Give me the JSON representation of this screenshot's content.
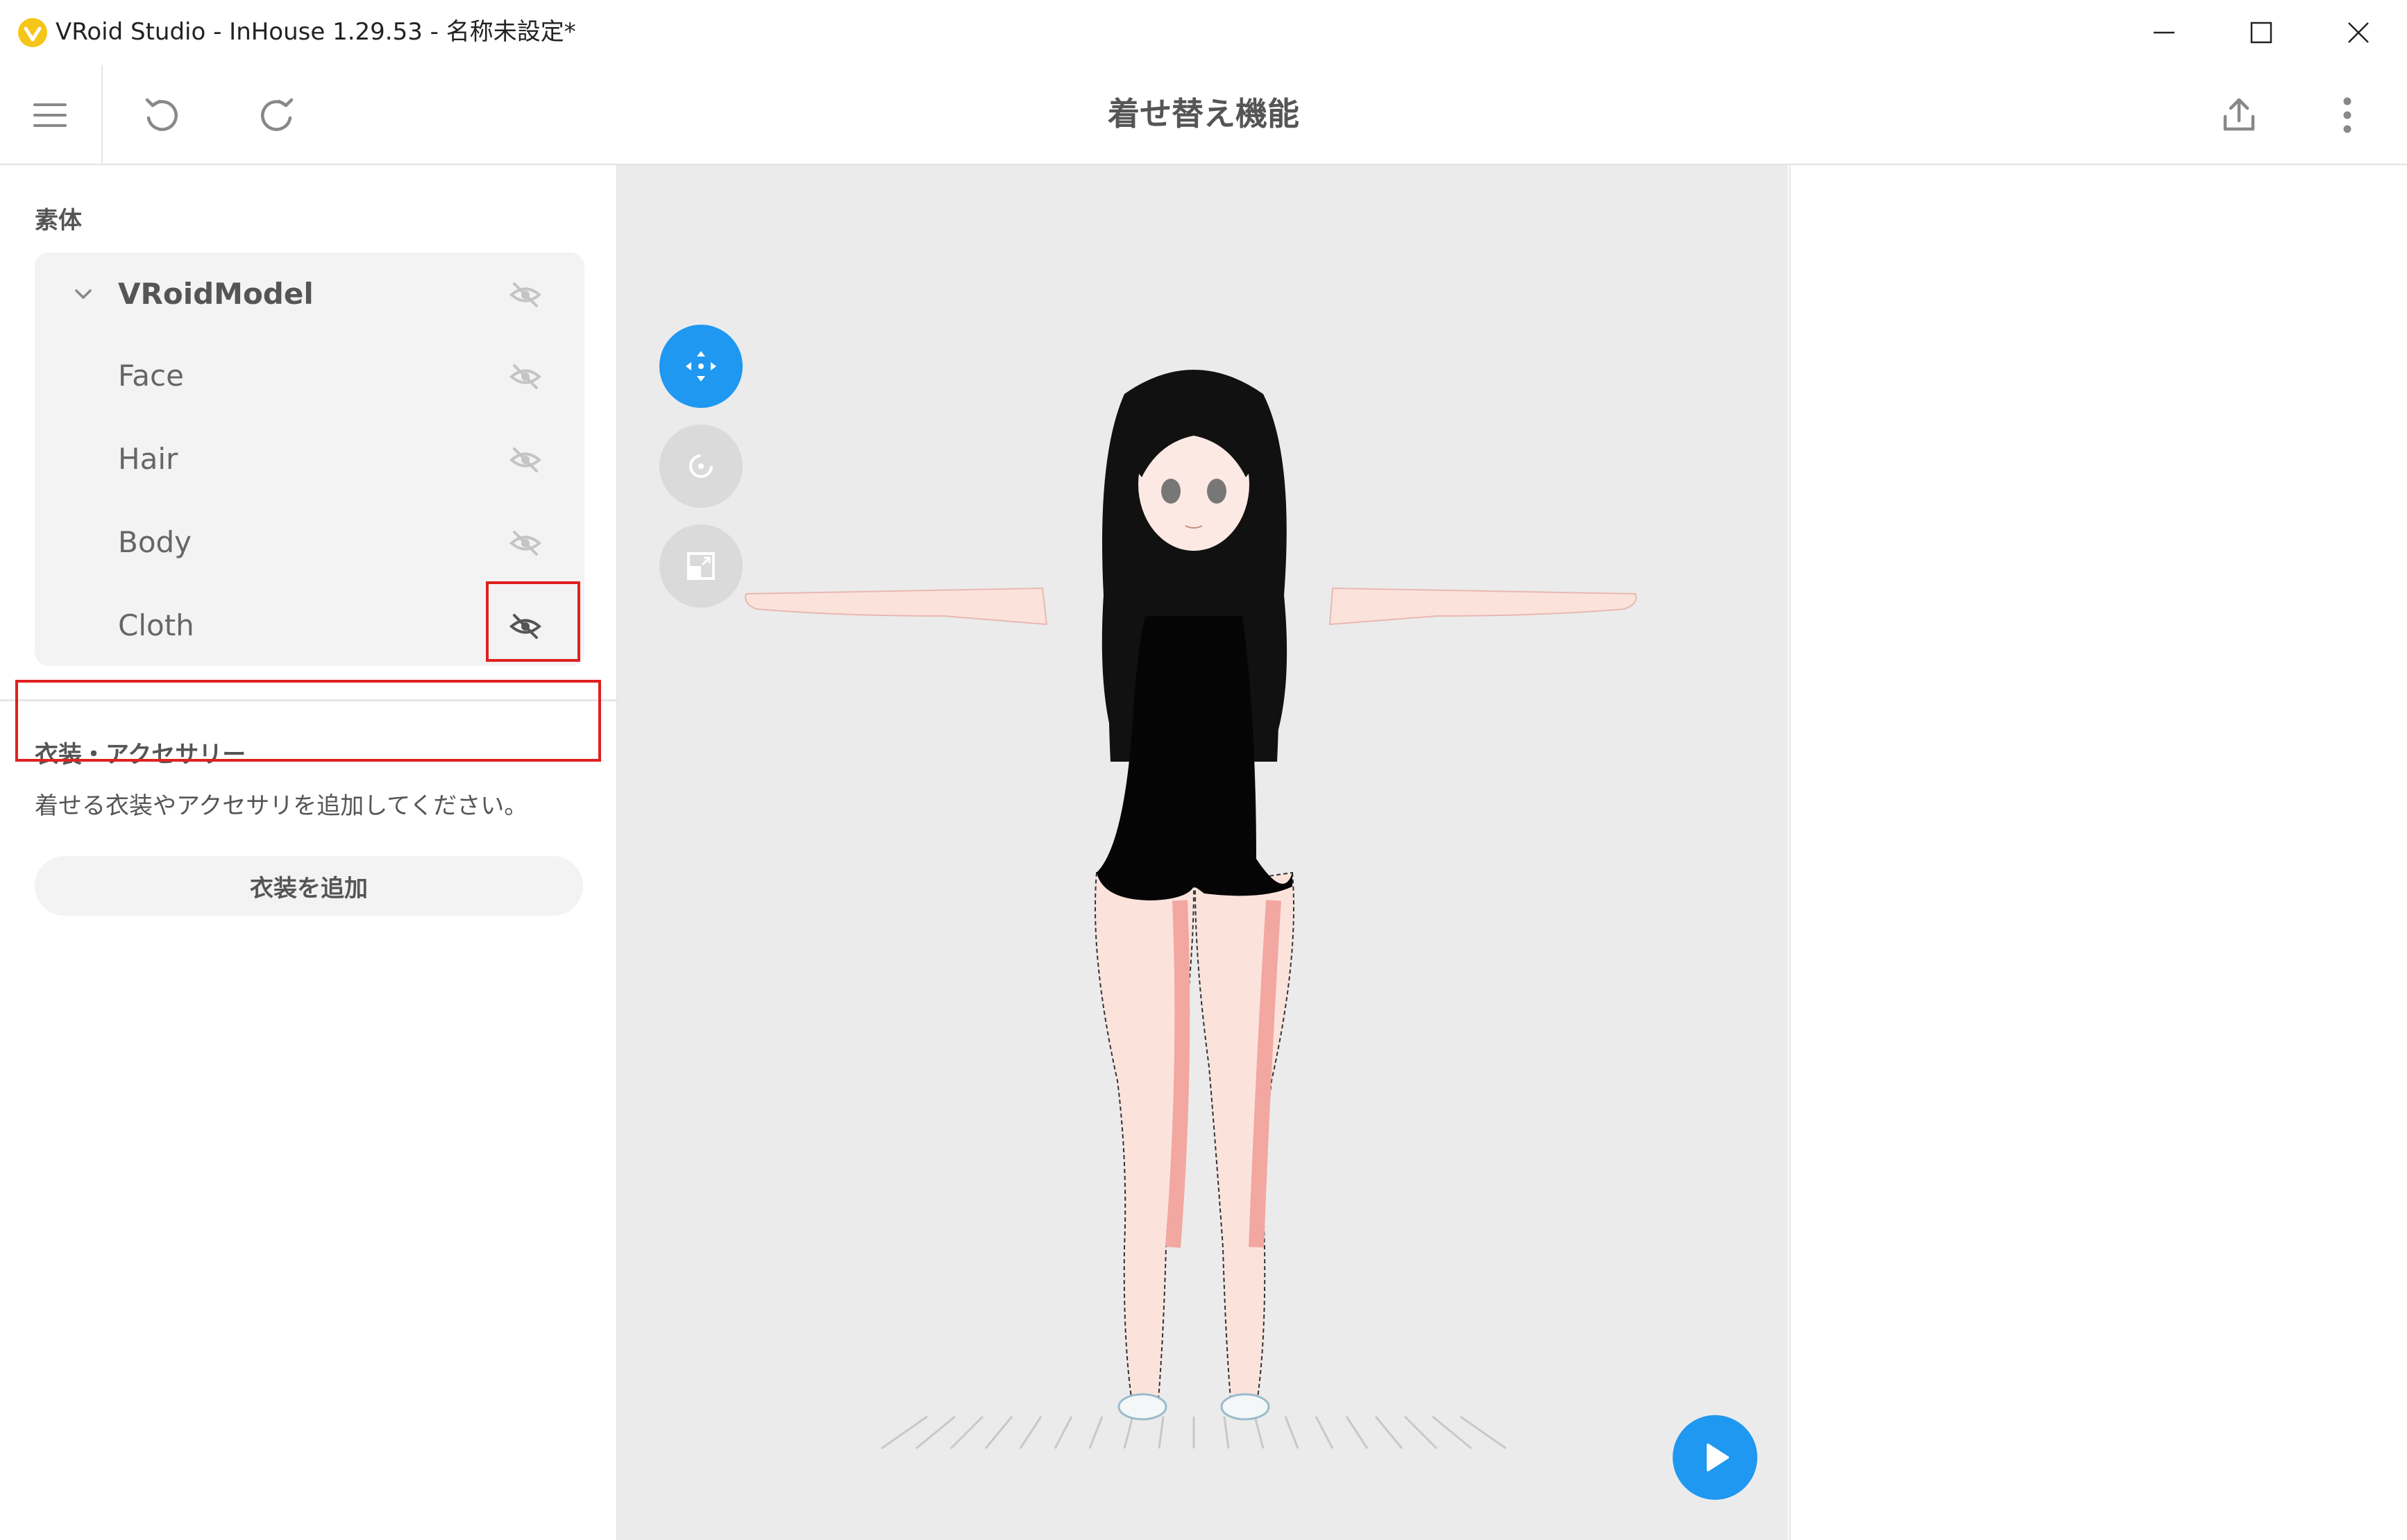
{
  "window": {
    "title": "VRoid Studio - InHouse 1.29.53 - 名称未設定*",
    "brand_color": "#f5c518"
  },
  "toolbar": {
    "title": "着せ替え機能",
    "icons": [
      "menu-icon",
      "undo-icon",
      "redo-icon",
      "export-icon",
      "more-vertical-icon"
    ]
  },
  "left_panel": {
    "body_section_title": "素体",
    "tree": {
      "root": "VRoidModel",
      "children": [
        "Face",
        "Hair",
        "Body",
        "Cloth"
      ]
    },
    "outfit_section_title": "衣装・アクセサリー",
    "outfit_description": "着せる衣装やアクセサリを追加してください。",
    "add_button_label": "衣装を追加"
  },
  "viewport": {
    "accent_color": "#1e98f0",
    "tools": [
      "move-icon",
      "rotate-icon",
      "zoom-icon"
    ],
    "play_icon": "play-icon"
  },
  "highlight_color": "#e02020"
}
